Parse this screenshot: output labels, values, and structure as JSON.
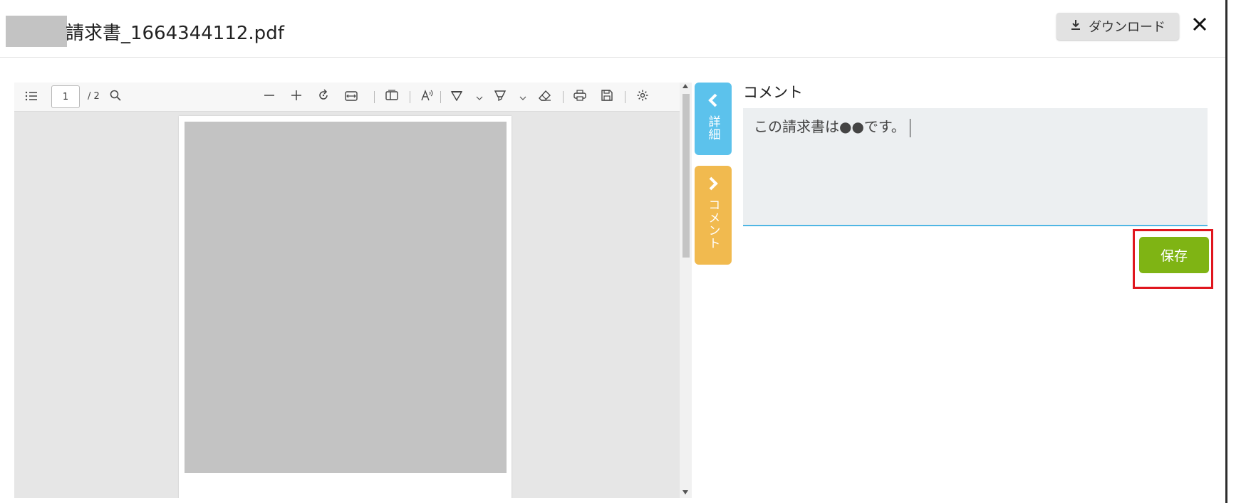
{
  "header": {
    "title": "請求書_1664344112.pdf",
    "download_label": "ダウンロード"
  },
  "viewer": {
    "current_page": "1",
    "page_total": "/ 2"
  },
  "side_tabs": {
    "details_label": "詳細",
    "comment_label": "コメント",
    "details_color": "#5cc2ec",
    "comment_color": "#f1ba4f"
  },
  "comment_panel": {
    "heading": "コメント",
    "text": "この請求書は●●です。",
    "save_label": "保存",
    "save_color": "#7fb414",
    "highlight_color": "#e0161e"
  }
}
